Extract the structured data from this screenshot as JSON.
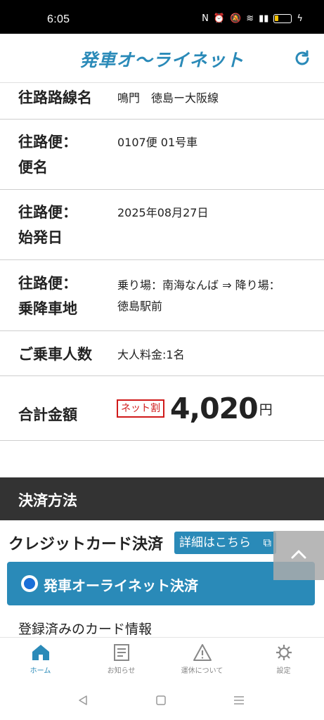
{
  "status": {
    "time": "6:05"
  },
  "header": {
    "logo": "発車オ〜ライネット",
    "refresh_icon": "refresh-icon"
  },
  "rows": [
    {
      "label": "往路路線名",
      "value": "鳴門　徳島ー大阪線"
    },
    {
      "label": "往路便：\n便名",
      "value": "0107便 01号車"
    },
    {
      "label": "往路便：\n始発日",
      "value": "2025年08月27日"
    },
    {
      "label": "往路便：\n乗降車地",
      "value": "乗り場：南海なんば ⇒ 降り場：\n徳島駅前"
    },
    {
      "label": "ご乗車人数",
      "value": "大人料金:1名"
    }
  ],
  "total": {
    "label": "合計金額",
    "badge": "ネット割",
    "amount": "4,020",
    "unit": "円"
  },
  "payment": {
    "section_title": "決済方法",
    "cc_title": "クレジットカード決済",
    "detail_button": "詳細はこちら",
    "option": "発車オーライネット決済",
    "registered_card": "登録済みのカード情報"
  },
  "tabs": [
    {
      "label": "ホーム",
      "icon": "home-icon",
      "active": true
    },
    {
      "label": "お知らせ",
      "icon": "news-icon",
      "active": false
    },
    {
      "label": "運休について",
      "icon": "warning-icon",
      "active": false
    },
    {
      "label": "設定",
      "icon": "gear-icon",
      "active": false
    }
  ],
  "colors": {
    "accent": "#2a8ab8",
    "badge": "#d01a1a",
    "section_head": "#333333"
  }
}
